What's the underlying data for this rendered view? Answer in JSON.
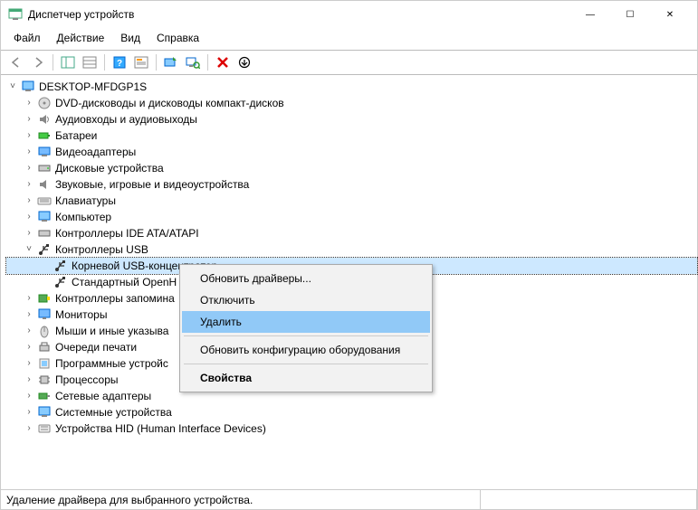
{
  "window": {
    "title": "Диспетчер устройств"
  },
  "winbuttons": {
    "min": "—",
    "max": "☐",
    "close": "✕"
  },
  "menu": {
    "file": "Файл",
    "action": "Действие",
    "view": "Вид",
    "help": "Справка"
  },
  "tree": {
    "root": "DESKTOP-MFDGP1S",
    "items": [
      "DVD-дисководы и дисководы компакт-дисков",
      "Аудиовходы и аудиовыходы",
      "Батареи",
      "Видеоадаптеры",
      "Дисковые устройства",
      "Звуковые, игровые и видеоустройства",
      "Клавиатуры",
      "Компьютер",
      "Контроллеры IDE ATA/ATAPI",
      "Контроллеры USB",
      "Контроллеры запомина",
      "Мониторы",
      "Мыши и иные указыва",
      "Очереди печати",
      "Программные устройс",
      "Процессоры",
      "Сетевые адаптеры",
      "Системные устройства",
      "Устройства HID (Human Interface Devices)"
    ],
    "usb_children": [
      "Корневой USB-концентратор",
      "Стандартный OpenH"
    ]
  },
  "context_menu": {
    "update": "Обновить драйверы...",
    "disable": "Отключить",
    "delete": "Удалить",
    "scan": "Обновить конфигурацию оборудования",
    "props": "Свойства"
  },
  "status": "Удаление драйвера для выбранного устройства."
}
